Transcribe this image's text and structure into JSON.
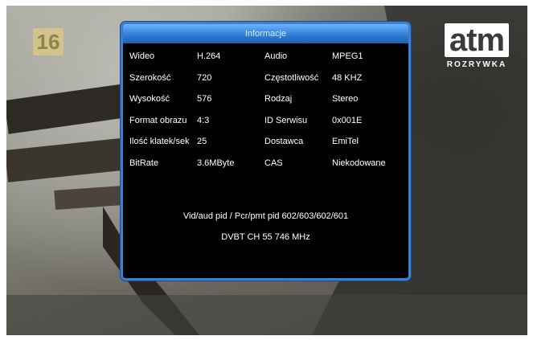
{
  "overlay": {
    "rating": "16",
    "channel_logo": {
      "main": "atm",
      "sub": "ROZRYWKA"
    }
  },
  "dialog": {
    "title": "Informacje",
    "rows": [
      {
        "l1": "Wideo",
        "v1": "H.264",
        "l2": "Audio",
        "v2": "MPEG1"
      },
      {
        "l1": "Szerokość",
        "v1": "720",
        "l2": "Częstotliwość",
        "v2": "48 KHZ"
      },
      {
        "l1": "Wysokość",
        "v1": "576",
        "l2": "Rodzaj",
        "v2": "Stereo"
      },
      {
        "l1": "Format obrazu",
        "v1": "4:3",
        "l2": "ID Serwisu",
        "v2": "0x001E"
      },
      {
        "l1": "Ilość klatek/sek",
        "v1": "25",
        "l2": "Dostawca",
        "v2": "EmiTel"
      },
      {
        "l1": "BitRate",
        "v1": "3.6MByte",
        "l2": "CAS",
        "v2": "Niekodowane"
      }
    ],
    "pid_line": "Vid/aud pid / Pcr/pmt pid  602/603/602/601",
    "dvbt_line": "DVBT   CH 55  746 MHz"
  }
}
